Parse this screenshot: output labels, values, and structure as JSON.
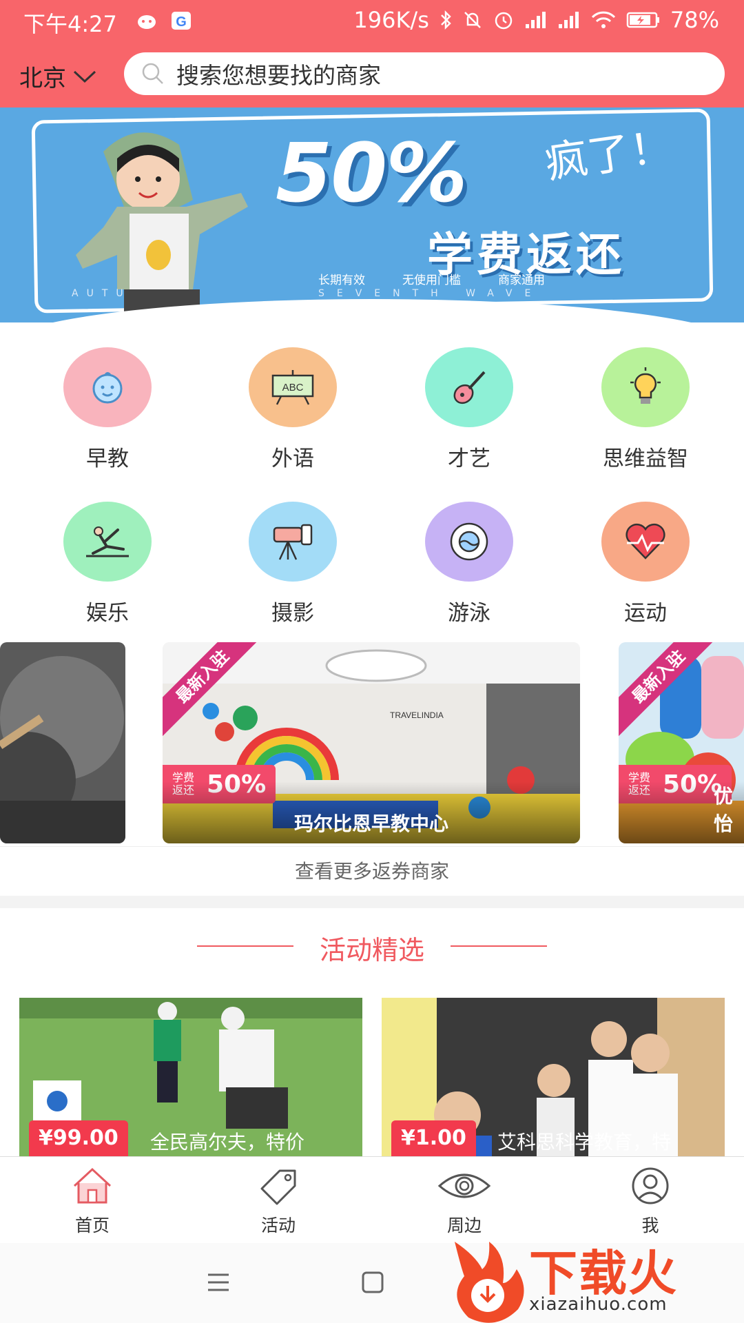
{
  "status_bar": {
    "time": "下午4:27",
    "net_speed": "196K/s",
    "battery": "78%"
  },
  "header": {
    "city": "北京",
    "search_placeholder": "搜索您想要找的商家"
  },
  "banner": {
    "percent": "50%",
    "crazy": "疯了！",
    "headline": "学费返还",
    "notes": [
      "长期有效",
      "无使用门槛",
      "商家通用"
    ],
    "en_left": "AUTU",
    "en_right": "SEVENTH WAVE"
  },
  "categories": [
    {
      "label": "早教",
      "color": "#f9b4bd",
      "icon": "baby-face-icon"
    },
    {
      "label": "外语",
      "color": "#f8c08c",
      "icon": "abc-board-icon"
    },
    {
      "label": "才艺",
      "color": "#8ef0d6",
      "icon": "guitar-icon"
    },
    {
      "label": "思维益智",
      "color": "#b8f29a",
      "icon": "lightbulb-icon"
    },
    {
      "label": "娱乐",
      "color": "#9ff0bd",
      "icon": "gymnast-icon"
    },
    {
      "label": "摄影",
      "color": "#a3dcf7",
      "icon": "camera-icon"
    },
    {
      "label": "游泳",
      "color": "#c6b2f5",
      "icon": "lifebuoy-icon"
    },
    {
      "label": "运动",
      "color": "#f8a886",
      "icon": "heartbeat-icon"
    }
  ],
  "merchants": {
    "ribbon": "最新入驻",
    "badge_small": "学费返还",
    "badge_big": "50%",
    "items": [
      {
        "name": "玛尔比恩早教中心"
      },
      {
        "name": "优怡"
      }
    ],
    "more": "查看更多返券商家"
  },
  "activities": {
    "title": "活动精选",
    "items": [
      {
        "price": "¥99.00",
        "text": "全民高尔夫，特价"
      },
      {
        "price": "¥1.00",
        "text": "艾科思科学教育，特"
      }
    ]
  },
  "tabbar": {
    "items": [
      {
        "label": "首页",
        "icon": "home-icon"
      },
      {
        "label": "活动",
        "icon": "tag-icon"
      },
      {
        "label": "周边",
        "icon": "eye-icon"
      },
      {
        "label": "我",
        "icon": "user-icon"
      }
    ]
  },
  "watermark": {
    "text": "下载火",
    "url": "xiazaihuo.com"
  }
}
